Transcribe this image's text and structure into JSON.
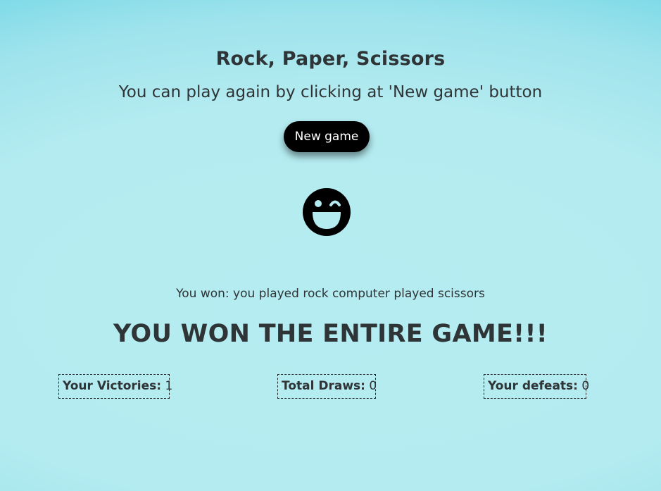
{
  "game": {
    "title": "Rock, Paper, Scissors",
    "subtitle": "You can play again by clicking at 'New game' button",
    "new_game_label": "New game",
    "result_icon": "winking-laughing-face-icon",
    "round_result": "You won: you played rock computer played scissors",
    "final_result": "YOU WON THE ENTIRE GAME!!!"
  },
  "scores": {
    "victories_label": "Your Victories:",
    "victories_value": "1",
    "draws_label": "Total Draws:",
    "draws_value": "0",
    "defeats_label": "Your defeats:",
    "defeats_value": "0"
  },
  "colors": {
    "background": "#b3ebf0",
    "text": "#2f3436",
    "button_bg": "#000000",
    "button_text": "#ffffff"
  }
}
